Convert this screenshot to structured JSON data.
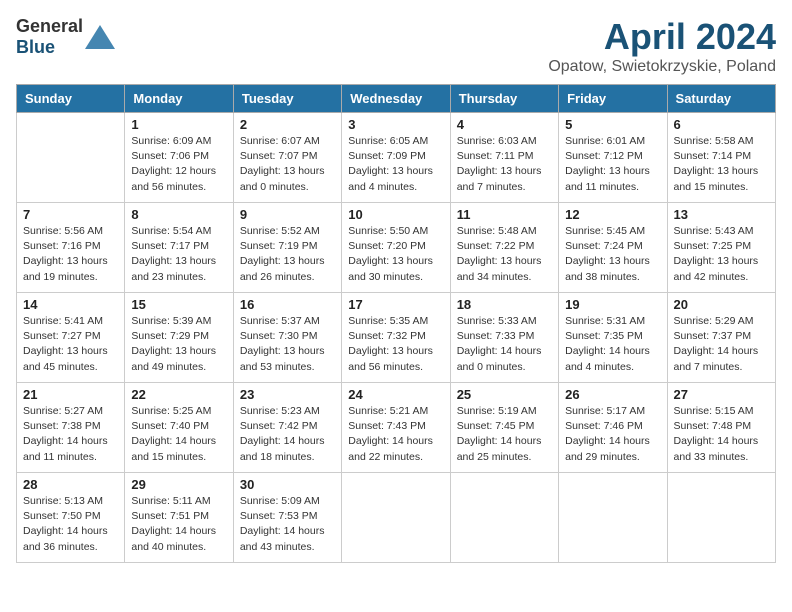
{
  "header": {
    "logo_general": "General",
    "logo_blue": "Blue",
    "month_year": "April 2024",
    "location": "Opatow, Swietokrzyskie, Poland"
  },
  "weekdays": [
    "Sunday",
    "Monday",
    "Tuesday",
    "Wednesday",
    "Thursday",
    "Friday",
    "Saturday"
  ],
  "weeks": [
    [
      {
        "day": "",
        "info": ""
      },
      {
        "day": "1",
        "info": "Sunrise: 6:09 AM\nSunset: 7:06 PM\nDaylight: 12 hours\nand 56 minutes."
      },
      {
        "day": "2",
        "info": "Sunrise: 6:07 AM\nSunset: 7:07 PM\nDaylight: 13 hours\nand 0 minutes."
      },
      {
        "day": "3",
        "info": "Sunrise: 6:05 AM\nSunset: 7:09 PM\nDaylight: 13 hours\nand 4 minutes."
      },
      {
        "day": "4",
        "info": "Sunrise: 6:03 AM\nSunset: 7:11 PM\nDaylight: 13 hours\nand 7 minutes."
      },
      {
        "day": "5",
        "info": "Sunrise: 6:01 AM\nSunset: 7:12 PM\nDaylight: 13 hours\nand 11 minutes."
      },
      {
        "day": "6",
        "info": "Sunrise: 5:58 AM\nSunset: 7:14 PM\nDaylight: 13 hours\nand 15 minutes."
      }
    ],
    [
      {
        "day": "7",
        "info": "Sunrise: 5:56 AM\nSunset: 7:16 PM\nDaylight: 13 hours\nand 19 minutes."
      },
      {
        "day": "8",
        "info": "Sunrise: 5:54 AM\nSunset: 7:17 PM\nDaylight: 13 hours\nand 23 minutes."
      },
      {
        "day": "9",
        "info": "Sunrise: 5:52 AM\nSunset: 7:19 PM\nDaylight: 13 hours\nand 26 minutes."
      },
      {
        "day": "10",
        "info": "Sunrise: 5:50 AM\nSunset: 7:20 PM\nDaylight: 13 hours\nand 30 minutes."
      },
      {
        "day": "11",
        "info": "Sunrise: 5:48 AM\nSunset: 7:22 PM\nDaylight: 13 hours\nand 34 minutes."
      },
      {
        "day": "12",
        "info": "Sunrise: 5:45 AM\nSunset: 7:24 PM\nDaylight: 13 hours\nand 38 minutes."
      },
      {
        "day": "13",
        "info": "Sunrise: 5:43 AM\nSunset: 7:25 PM\nDaylight: 13 hours\nand 42 minutes."
      }
    ],
    [
      {
        "day": "14",
        "info": "Sunrise: 5:41 AM\nSunset: 7:27 PM\nDaylight: 13 hours\nand 45 minutes."
      },
      {
        "day": "15",
        "info": "Sunrise: 5:39 AM\nSunset: 7:29 PM\nDaylight: 13 hours\nand 49 minutes."
      },
      {
        "day": "16",
        "info": "Sunrise: 5:37 AM\nSunset: 7:30 PM\nDaylight: 13 hours\nand 53 minutes."
      },
      {
        "day": "17",
        "info": "Sunrise: 5:35 AM\nSunset: 7:32 PM\nDaylight: 13 hours\nand 56 minutes."
      },
      {
        "day": "18",
        "info": "Sunrise: 5:33 AM\nSunset: 7:33 PM\nDaylight: 14 hours\nand 0 minutes."
      },
      {
        "day": "19",
        "info": "Sunrise: 5:31 AM\nSunset: 7:35 PM\nDaylight: 14 hours\nand 4 minutes."
      },
      {
        "day": "20",
        "info": "Sunrise: 5:29 AM\nSunset: 7:37 PM\nDaylight: 14 hours\nand 7 minutes."
      }
    ],
    [
      {
        "day": "21",
        "info": "Sunrise: 5:27 AM\nSunset: 7:38 PM\nDaylight: 14 hours\nand 11 minutes."
      },
      {
        "day": "22",
        "info": "Sunrise: 5:25 AM\nSunset: 7:40 PM\nDaylight: 14 hours\nand 15 minutes."
      },
      {
        "day": "23",
        "info": "Sunrise: 5:23 AM\nSunset: 7:42 PM\nDaylight: 14 hours\nand 18 minutes."
      },
      {
        "day": "24",
        "info": "Sunrise: 5:21 AM\nSunset: 7:43 PM\nDaylight: 14 hours\nand 22 minutes."
      },
      {
        "day": "25",
        "info": "Sunrise: 5:19 AM\nSunset: 7:45 PM\nDaylight: 14 hours\nand 25 minutes."
      },
      {
        "day": "26",
        "info": "Sunrise: 5:17 AM\nSunset: 7:46 PM\nDaylight: 14 hours\nand 29 minutes."
      },
      {
        "day": "27",
        "info": "Sunrise: 5:15 AM\nSunset: 7:48 PM\nDaylight: 14 hours\nand 33 minutes."
      }
    ],
    [
      {
        "day": "28",
        "info": "Sunrise: 5:13 AM\nSunset: 7:50 PM\nDaylight: 14 hours\nand 36 minutes."
      },
      {
        "day": "29",
        "info": "Sunrise: 5:11 AM\nSunset: 7:51 PM\nDaylight: 14 hours\nand 40 minutes."
      },
      {
        "day": "30",
        "info": "Sunrise: 5:09 AM\nSunset: 7:53 PM\nDaylight: 14 hours\nand 43 minutes."
      },
      {
        "day": "",
        "info": ""
      },
      {
        "day": "",
        "info": ""
      },
      {
        "day": "",
        "info": ""
      },
      {
        "day": "",
        "info": ""
      }
    ]
  ]
}
